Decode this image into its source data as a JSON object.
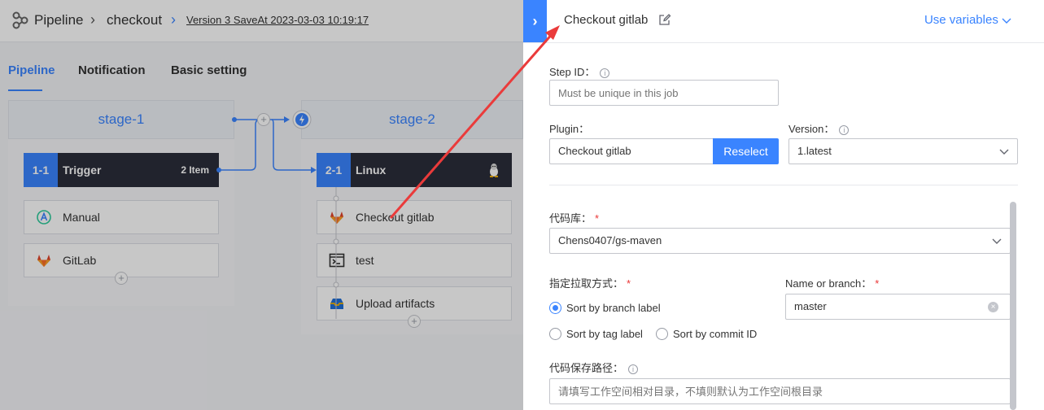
{
  "header": {
    "crumb_pipeline": "Pipeline",
    "crumb_name": "checkout",
    "version": "Version 3 SaveAt 2023-03-03 10:19:17"
  },
  "tabs": {
    "pipeline": "Pipeline",
    "notification": "Notification",
    "basic_setting": "Basic setting"
  },
  "stages": [
    {
      "title": "stage-1",
      "job": {
        "num": "1-1",
        "name": "Trigger",
        "extra": "2 Item"
      },
      "elements": [
        {
          "label": "Manual",
          "icon": "manual-trigger-icon"
        },
        {
          "label": "GitLab",
          "icon": "gitlab-icon"
        }
      ]
    },
    {
      "title": "stage-2",
      "job": {
        "num": "2-1",
        "name": "Linux",
        "extra_icon": "linux-icon"
      },
      "elements": [
        {
          "label": "Checkout gitlab",
          "icon": "gitlab-icon"
        },
        {
          "label": "test",
          "icon": "terminal-icon"
        },
        {
          "label": "Upload artifacts",
          "icon": "upload-artifacts-icon"
        }
      ]
    }
  ],
  "panel": {
    "title": "Checkout gitlab",
    "use_variables": "Use variables",
    "step_id_label": "Step ID：",
    "step_id_placeholder": "Must be unique in this job",
    "plugin_label": "Plugin：",
    "plugin_value": "Checkout gitlab",
    "reselect": "Reselect",
    "version_label": "Version：",
    "version_value": "1.latest",
    "repo_label": "代码库：",
    "repo_value": "Chens0407/gs-maven",
    "pull_mode_label": "指定拉取方式：",
    "branch_name_label": "Name or branch：",
    "branch_name_value": "master",
    "radio_branch": "Sort by branch label",
    "radio_tag": "Sort by tag label",
    "radio_commit": "Sort by commit ID",
    "save_path_label": "代码保存路径：",
    "save_path_placeholder": "请填写工作空间相对目录，不填则默认为工作空间根目录"
  },
  "colors": {
    "accent": "#3a84ff",
    "job_header": "#2b2d3a",
    "required": "#ea3636",
    "annotation_arrow": "#ea3b3b"
  }
}
